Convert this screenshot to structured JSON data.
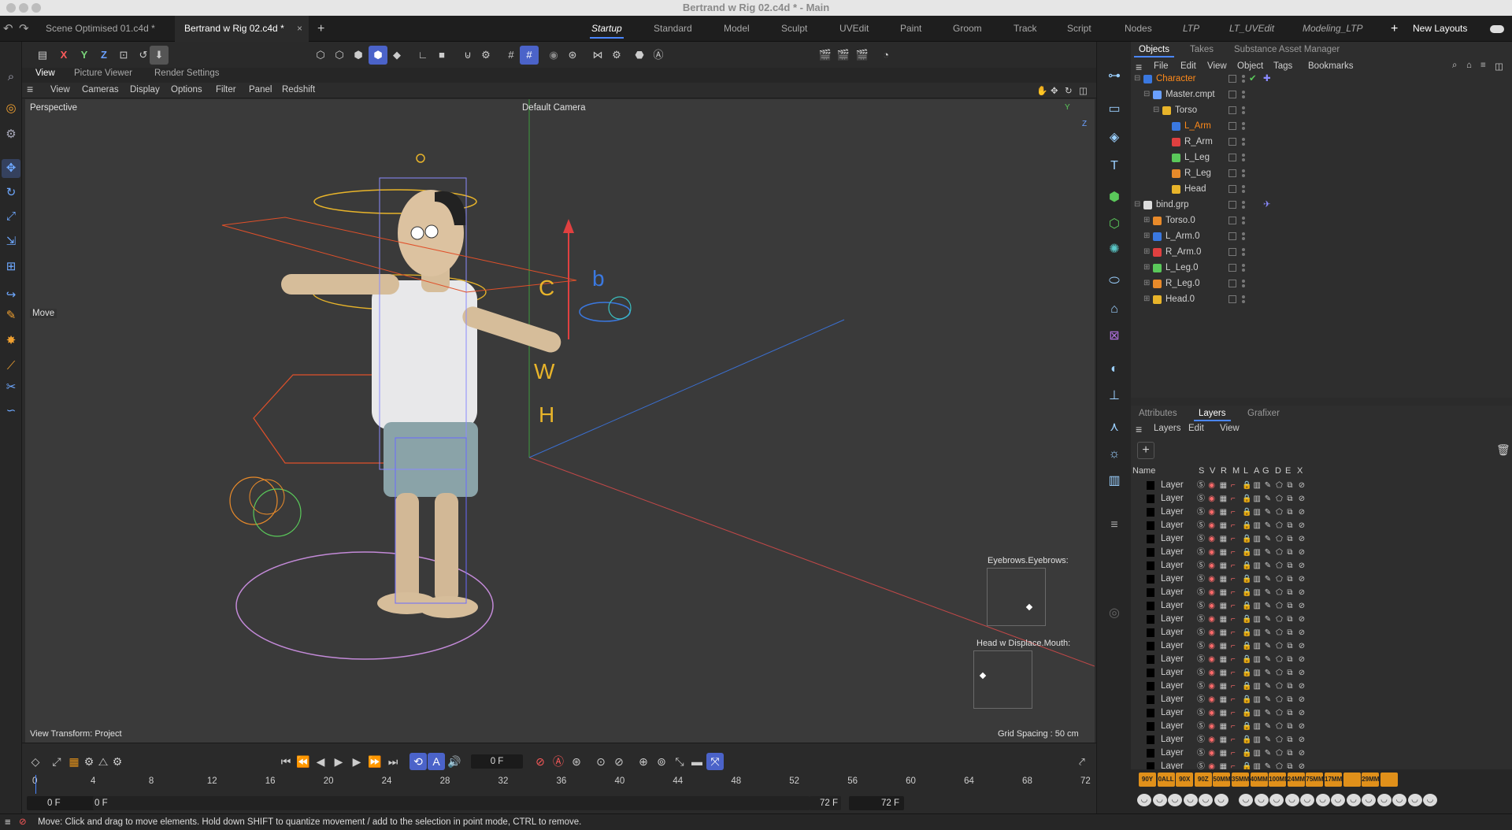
{
  "window": {
    "title": "Bertrand w Rig 02.c4d * - Main"
  },
  "doc_tabs": [
    {
      "label": "Scene Optimised 01.c4d *"
    },
    {
      "label": "Bertrand w Rig 02.c4d *"
    }
  ],
  "layouts": [
    "Startup",
    "Standard",
    "Model",
    "Sculpt",
    "UVEdit",
    "Paint",
    "Groom",
    "Track",
    "Script",
    "Nodes",
    "LTP",
    "LT_UVEdit",
    "Modeling_LTP"
  ],
  "new_layouts_label": "New Layouts",
  "axis_buttons": {
    "x": "X",
    "y": "Y",
    "z": "Z"
  },
  "view_tabs": [
    "View",
    "Picture Viewer",
    "Render Settings"
  ],
  "view_menu": [
    "View",
    "Cameras",
    "Display",
    "Options",
    "Filter",
    "Panel",
    "Redshift"
  ],
  "viewport": {
    "projection": "Perspective",
    "camera": "Default Camera",
    "tool_label": "Move",
    "view_transform": "View Transform: Project",
    "grid_spacing": "Grid Spacing : 50 cm",
    "axis_letters": {
      "c": "C",
      "b": "b",
      "w": "W",
      "h": "H"
    },
    "gizmo_axes": {
      "y": "Y",
      "z": "Z"
    },
    "mini_views": [
      {
        "label": "Eyebrows.Eyebrows:"
      },
      {
        "label": "Head w Displace.Mouth:"
      }
    ]
  },
  "object_panel": {
    "tabs": [
      "Objects",
      "Takes",
      "Substance Asset Manager"
    ],
    "menu": [
      "File",
      "Edit",
      "View",
      "Object",
      "Tags",
      "Bookmarks"
    ],
    "rows": [
      {
        "name": "Character",
        "color": "#ff8a1a"
      },
      {
        "name": "Master.cmpt",
        "color": "#d0d0d0"
      },
      {
        "name": "Torso",
        "color": "#d0d0d0"
      },
      {
        "name": "L_Arm",
        "color": "#ff8a1a"
      },
      {
        "name": "R_Arm",
        "color": "#d0d0d0"
      },
      {
        "name": "L_Leg",
        "color": "#d0d0d0"
      },
      {
        "name": "R_Leg",
        "color": "#d0d0d0"
      },
      {
        "name": "Head",
        "color": "#d0d0d0"
      },
      {
        "name": "bind.grp",
        "color": "#d0d0d0"
      },
      {
        "name": "Torso.0",
        "color": "#d0d0d0"
      },
      {
        "name": "L_Arm.0",
        "color": "#d0d0d0"
      },
      {
        "name": "R_Arm.0",
        "color": "#d0d0d0"
      },
      {
        "name": "L_Leg.0",
        "color": "#d0d0d0"
      },
      {
        "name": "R_Leg.0",
        "color": "#d0d0d0"
      },
      {
        "name": "Head.0",
        "color": "#d0d0d0"
      }
    ]
  },
  "layer_panel": {
    "tabs": [
      "Attributes",
      "Layers",
      "Grafixer"
    ],
    "menu": [
      "Layers",
      "Edit",
      "View"
    ],
    "columns": [
      "Name",
      "S",
      "V",
      "R",
      "M",
      "L",
      "A",
      "G",
      "D",
      "E",
      "X"
    ],
    "layer_name": "Layer",
    "layer_count": 22
  },
  "camera_buttons_row1": [
    "90Y",
    "0ALL",
    "90X",
    "90Z",
    "50MM",
    "35MM",
    "40MM",
    "100MM",
    "24MM",
    "75MM",
    "17MM",
    "",
    "29MM",
    ""
  ],
  "timeline": {
    "current_frame": "0 F",
    "ruler": [
      "0",
      "4",
      "8",
      "12",
      "16",
      "20",
      "24",
      "28",
      "32",
      "36",
      "40",
      "44",
      "48",
      "52",
      "56",
      "60",
      "64",
      "68",
      "72"
    ],
    "start_field": "0 F",
    "start_field2": "0 F",
    "end_field": "72 F",
    "end_field2": "72 F"
  },
  "status_bar": {
    "message": "Move: Click and drag to move elements. Hold down SHIFT to quantize movement / add to the selection in point mode, CTRL to remove."
  }
}
